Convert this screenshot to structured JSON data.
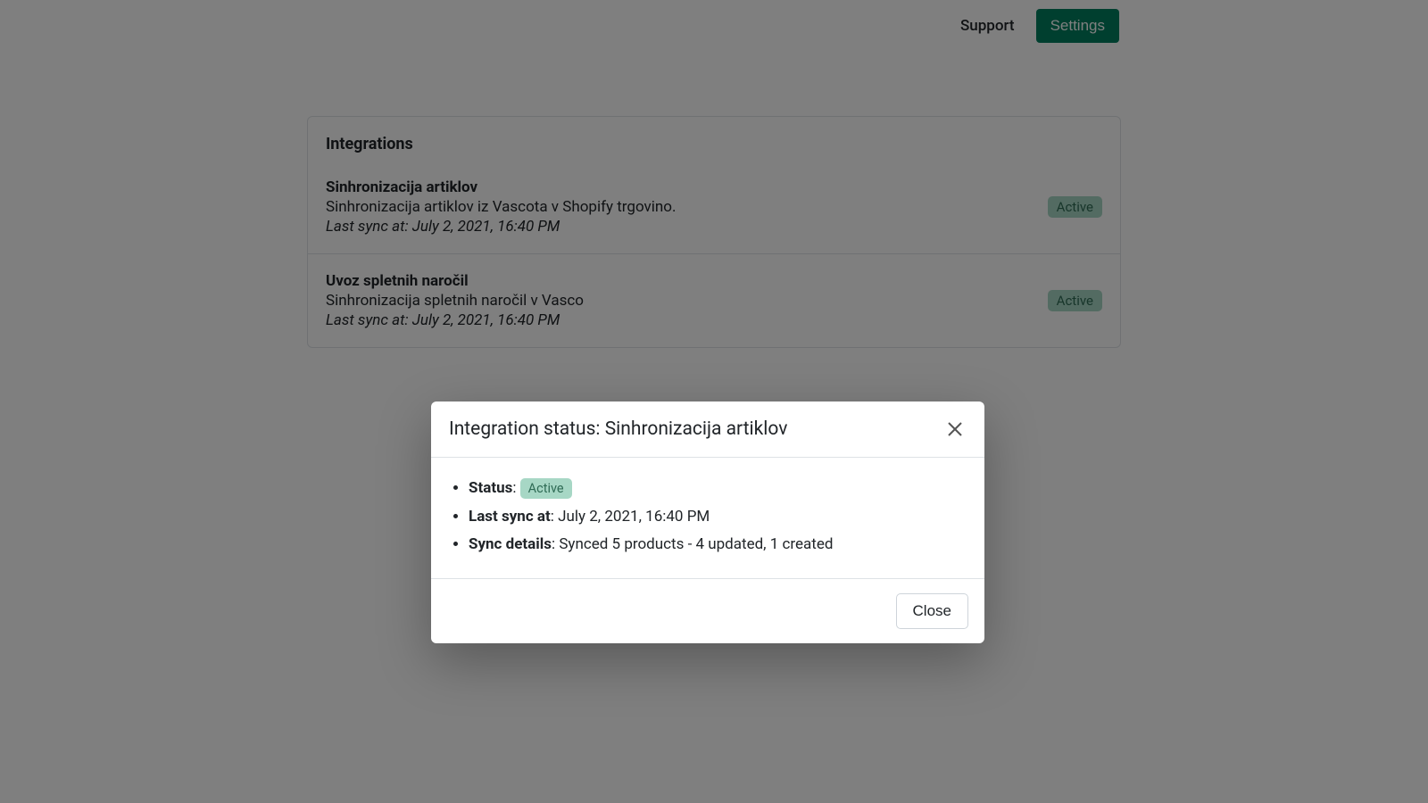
{
  "header": {
    "support_label": "Support",
    "settings_label": "Settings"
  },
  "card": {
    "title": "Integrations"
  },
  "integrations": [
    {
      "title": "Sinhronizacija artiklov",
      "description": "Sinhronizacija artiklov iz Vascota v Shopify trgovino.",
      "last_sync": "Last sync at: July 2, 2021, 16:40 PM",
      "status": "Active"
    },
    {
      "title": "Uvoz spletnih naročil",
      "description": "Sinhronizacija spletnih naročil v Vasco",
      "last_sync": "Last sync at: July 2, 2021, 16:40 PM",
      "status": "Active"
    }
  ],
  "modal": {
    "title": "Integration status: Sinhronizacija artiklov",
    "status_label": "Status",
    "status_value": "Active",
    "last_sync_label": "Last sync at",
    "last_sync_value": "July 2, 2021, 16:40 PM",
    "sync_details_label": "Sync details",
    "sync_details_value": "Synced 5 products - 4 updated, 1 created",
    "close_label": "Close"
  }
}
